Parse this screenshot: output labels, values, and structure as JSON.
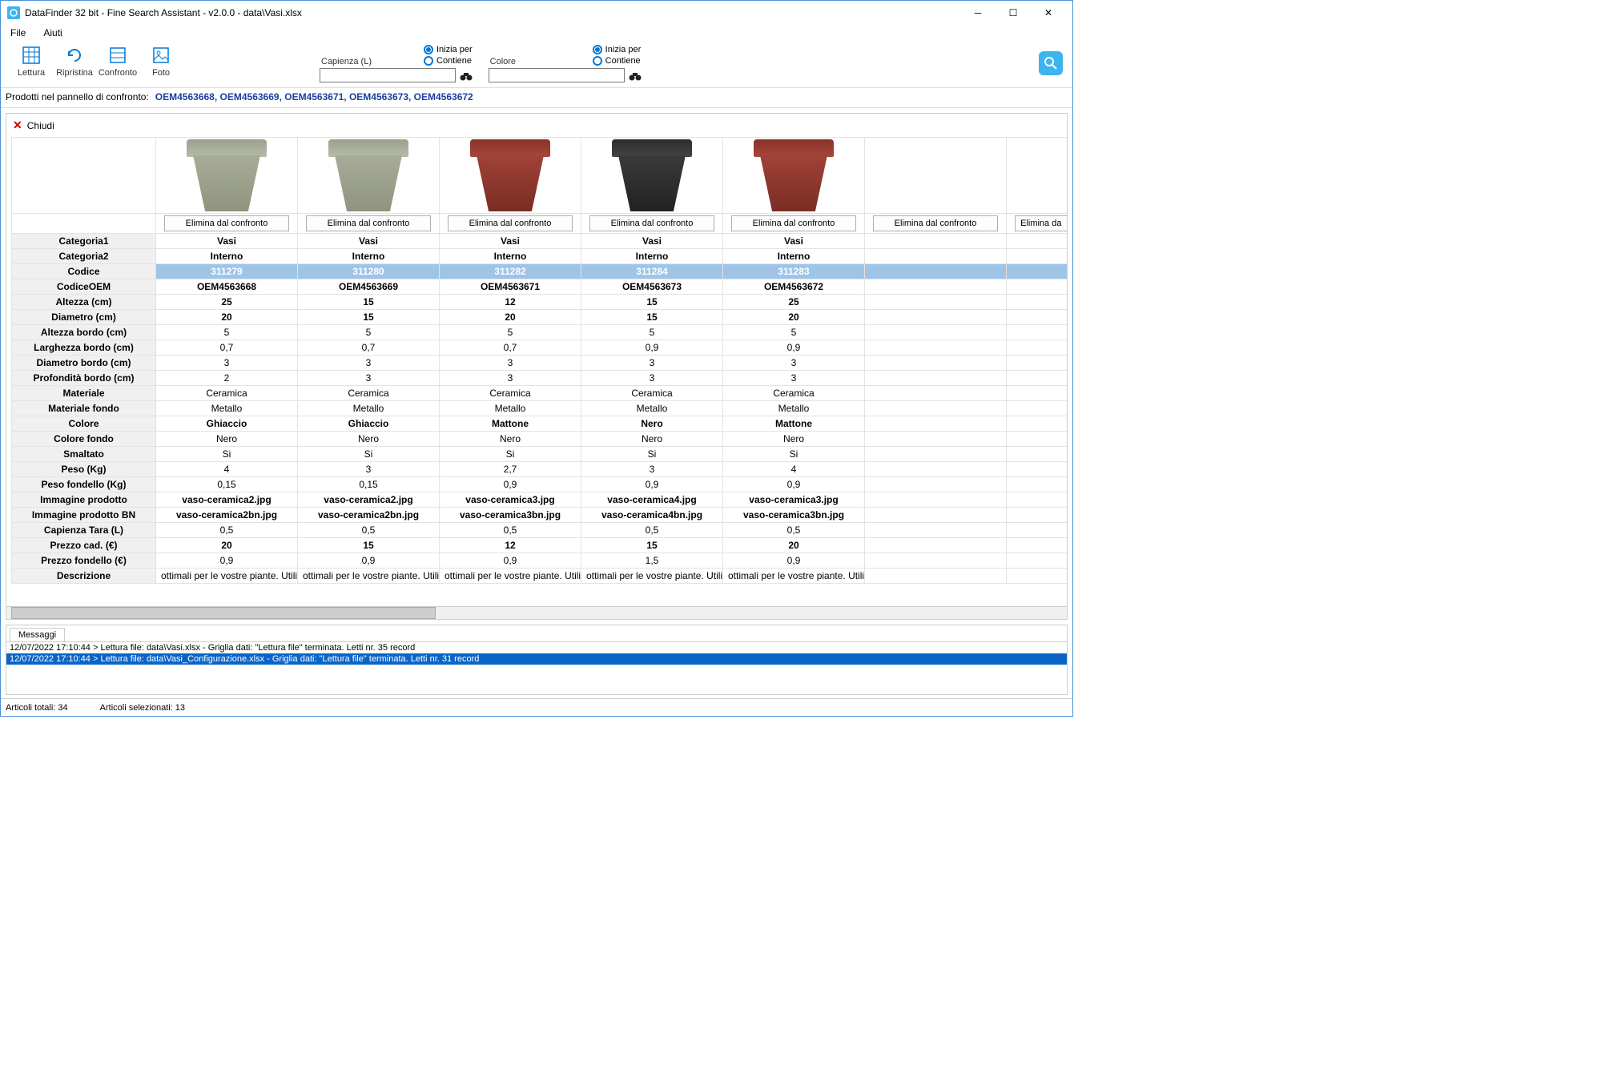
{
  "window": {
    "title": "DataFinder 32 bit - Fine Search Assistant - v2.0.0 - data\\Vasi.xlsx"
  },
  "menubar": {
    "file": "File",
    "help": "Aiuti"
  },
  "toolbar": {
    "lettura": "Lettura",
    "ripristina": "Ripristina",
    "confronto": "Confronto",
    "foto": "Foto"
  },
  "search": {
    "capienza_label": "Capienza (L)",
    "colore_label": "Colore",
    "inizia_per": "Inizia per",
    "contiene": "Contiene"
  },
  "products_label": "Prodotti nel pannello di confronto:",
  "products_codes": "OEM4563668, OEM4563669, OEM4563671, OEM4563673, OEM4563672",
  "close_label": "Chiudi",
  "elim_label": "Elimina dal confronto",
  "elim_partial": "Elimina da",
  "attrs": [
    "Categoria1",
    "Categoria2",
    "Codice",
    "CodiceOEM",
    "Altezza (cm)",
    "Diametro (cm)",
    "Altezza bordo (cm)",
    "Larghezza bordo (cm)",
    "Diametro bordo (cm)",
    "Profondità bordo (cm)",
    "Materiale",
    "Materiale fondo",
    "Colore",
    "Colore fondo",
    "Smaltato",
    "Peso (Kg)",
    "Peso fondello (Kg)",
    "Immagine prodotto",
    "Immagine prodotto BN",
    "Capienza Tara (L)",
    "Prezzo cad. (€)",
    "Prezzo fondello (€)",
    "Descrizione"
  ],
  "bold_rows": [
    0,
    1,
    2,
    3,
    4,
    5,
    12,
    17,
    18,
    20
  ],
  "cols": [
    {
      "color": "ghiaccio",
      "vals": [
        "Vasi",
        "Interno",
        "311279",
        "OEM4563668",
        "25",
        "20",
        "5",
        "0,7",
        "3",
        "2",
        "Ceramica",
        "Metallo",
        "Ghiaccio",
        "Nero",
        "Si",
        "4",
        "0,15",
        "vaso-ceramica2.jpg",
        "vaso-ceramica2bn.jpg",
        "0,5",
        "20",
        "0,9",
        "ottimali per le vostre piante. Utilizzat"
      ]
    },
    {
      "color": "ghiaccio",
      "vals": [
        "Vasi",
        "Interno",
        "311280",
        "OEM4563669",
        "15",
        "15",
        "5",
        "0,7",
        "3",
        "3",
        "Ceramica",
        "Metallo",
        "Ghiaccio",
        "Nero",
        "Si",
        "3",
        "0,15",
        "vaso-ceramica2.jpg",
        "vaso-ceramica2bn.jpg",
        "0,5",
        "15",
        "0,9",
        "ottimali per le vostre piante. Utilizzat"
      ]
    },
    {
      "color": "mattone",
      "vals": [
        "Vasi",
        "Interno",
        "311282",
        "OEM4563671",
        "12",
        "20",
        "5",
        "0,7",
        "3",
        "3",
        "Ceramica",
        "Metallo",
        "Mattone",
        "Nero",
        "Si",
        "2,7",
        "0,9",
        "vaso-ceramica3.jpg",
        "vaso-ceramica3bn.jpg",
        "0,5",
        "12",
        "0,9",
        "ottimali per le vostre piante. Utilizzat"
      ]
    },
    {
      "color": "nero",
      "vals": [
        "Vasi",
        "Interno",
        "311284",
        "OEM4563673",
        "15",
        "15",
        "5",
        "0,9",
        "3",
        "3",
        "Ceramica",
        "Metallo",
        "Nero",
        "Nero",
        "Si",
        "3",
        "0,9",
        "vaso-ceramica4.jpg",
        "vaso-ceramica4bn.jpg",
        "0,5",
        "15",
        "1,5",
        "ottimali per le vostre piante. Utilizzat"
      ]
    },
    {
      "color": "mattone",
      "vals": [
        "Vasi",
        "Interno",
        "311283",
        "OEM4563672",
        "25",
        "20",
        "5",
        "0,9",
        "3",
        "3",
        "Ceramica",
        "Metallo",
        "Mattone",
        "Nero",
        "Si",
        "4",
        "0,9",
        "vaso-ceramica3.jpg",
        "vaso-ceramica3bn.jpg",
        "0,5",
        "20",
        "0,9",
        "ottimali per le vostre piante. Utilizzat"
      ]
    }
  ],
  "messages_tab": "Messaggi",
  "messages": [
    "12/07/2022 17:10:44 > Lettura file: data\\Vasi.xlsx - Griglia dati: \"Lettura file\" terminata. Letti nr. 35 record",
    "12/07/2022 17:10:44 > Lettura file: data\\Vasi_Configurazione.xlsx - Griglia dati: \"Lettura file\" terminata. Letti nr. 31 record"
  ],
  "status": {
    "totali": "Articoli totali: 34",
    "selezionati": "Articoli selezionati: 13"
  }
}
